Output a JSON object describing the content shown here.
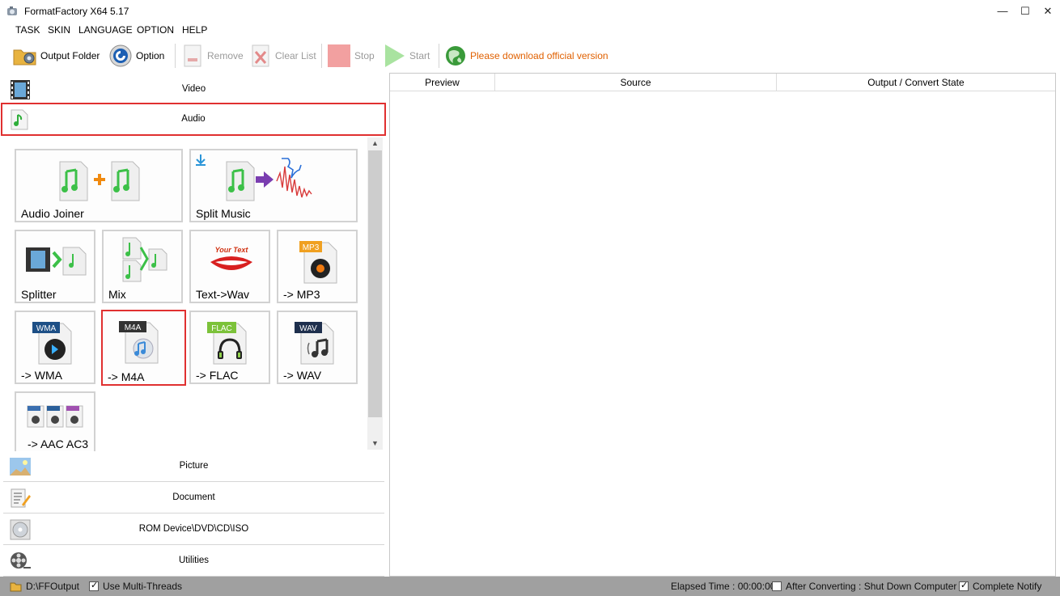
{
  "window": {
    "title": "FormatFactory X64 5.17",
    "minimize": "—",
    "maximize": "☐",
    "close": "✕"
  },
  "menu": [
    "TASK",
    "SKIN",
    "LANGUAGE",
    "OPTION",
    "HELP"
  ],
  "toolbar": {
    "output_folder": "Output Folder",
    "option": "Option",
    "remove": "Remove",
    "clear_list": "Clear List",
    "stop": "Stop",
    "start": "Start",
    "notice": "Please download official version"
  },
  "categories": {
    "video": "Video",
    "audio": "Audio",
    "picture": "Picture",
    "document": "Document",
    "rom": "ROM Device\\DVD\\CD\\ISO",
    "utilities": "Utilities"
  },
  "tiles": {
    "audio_joiner": "Audio Joiner",
    "split_music": "Split Music",
    "splitter": "Splitter",
    "mix": "Mix",
    "text_wav": "Text->Wav",
    "mp3": "-> MP3",
    "wma": "-> WMA",
    "m4a": "-> M4A",
    "flac": "-> FLAC",
    "wav": "-> WAV",
    "aac_ac3": "-> AAC AC3"
  },
  "badges": {
    "mp3": "MP3",
    "wma": "WMA",
    "m4a": "M4A",
    "flac": "FLAC",
    "wav": "WAV",
    "your_text": "Your Text"
  },
  "table": {
    "columns": [
      "Preview",
      "Source",
      "Output / Convert State"
    ]
  },
  "status": {
    "path": "D:\\FFOutput",
    "multi_threads": "Use Multi-Threads",
    "elapsed": "Elapsed Time : 00:00:00",
    "after_converting": "After Converting : Shut Down Computer",
    "complete_notify": "Complete Notify"
  },
  "colors": {
    "selection": "#e03030",
    "notice": "#e06000",
    "status_bar": "#a0a0a0"
  }
}
